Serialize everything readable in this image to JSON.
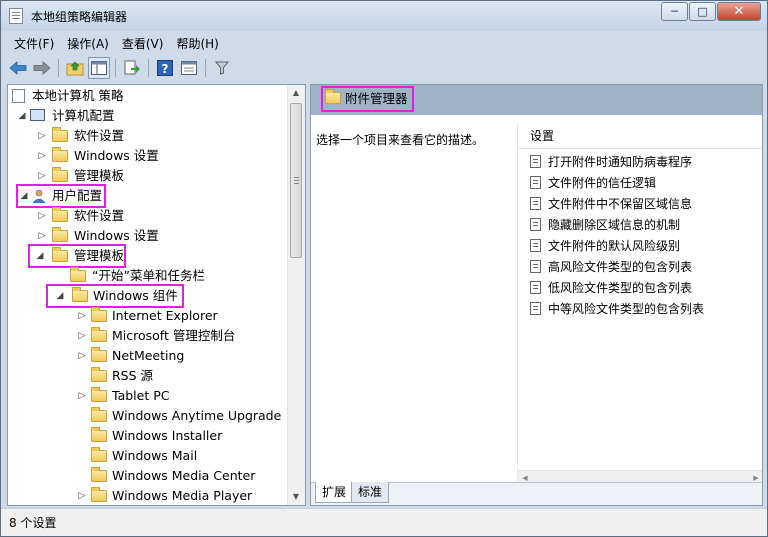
{
  "window": {
    "title": "本地组策略编辑器",
    "controls": {
      "minimize": "─",
      "maximize": "□",
      "close": "✕"
    }
  },
  "menu": [
    "文件(F)",
    "操作(A)",
    "查看(V)",
    "帮助(H)"
  ],
  "toolbar": {
    "icons": [
      "back-arrow-icon",
      "forward-arrow-icon",
      "up-folder-icon",
      "show-hide-tree-icon",
      "export-list-icon",
      "help-icon",
      "properties-icon",
      "filter-icon"
    ]
  },
  "tree": {
    "items": [
      {
        "label": "本地计算机 策略",
        "expander": ""
      },
      {
        "label": "计算机配置",
        "expander": "◢"
      },
      {
        "label": "软件设置",
        "expander": "▷"
      },
      {
        "label": "Windows 设置",
        "expander": "▷"
      },
      {
        "label": "管理模板",
        "expander": "▷"
      },
      {
        "label": "用户配置",
        "expander": "◢"
      },
      {
        "label": "软件设置",
        "expander": "▷"
      },
      {
        "label": "Windows 设置",
        "expander": "▷"
      },
      {
        "label": "管理模板",
        "expander": "◢"
      },
      {
        "label": "“开始”菜单和任务栏",
        "expander": ""
      },
      {
        "label": "Windows 组件",
        "expander": "◢"
      },
      {
        "label": "Internet Explorer",
        "expander": "▷"
      },
      {
        "label": "Microsoft 管理控制台",
        "expander": "▷"
      },
      {
        "label": "NetMeeting",
        "expander": "▷"
      },
      {
        "label": "RSS 源",
        "expander": ""
      },
      {
        "label": "Tablet PC",
        "expander": "▷"
      },
      {
        "label": "Windows Anytime Upgrade",
        "expander": ""
      },
      {
        "label": "Windows Installer",
        "expander": ""
      },
      {
        "label": "Windows Mail",
        "expander": ""
      },
      {
        "label": "Windows Media Center",
        "expander": ""
      },
      {
        "label": "Windows Media Player",
        "expander": "▷"
      }
    ]
  },
  "details": {
    "folder_title": "附件管理器",
    "description": "选择一个项目来查看它的描述。",
    "column_header": "设置",
    "settings": [
      "打开附件时通知防病毒程序",
      "文件附件的信任逻辑",
      "文件附件中不保留区域信息",
      "隐藏删除区域信息的机制",
      "文件附件的默认风险级别",
      "高风险文件类型的包含列表",
      "低风险文件类型的包含列表",
      "中等风险文件类型的包含列表"
    ],
    "tabs": [
      "扩展",
      "标准"
    ]
  },
  "status": "8 个设置",
  "colors": {
    "highlight": "#e020e0",
    "header_band": "#9fb3c7"
  }
}
